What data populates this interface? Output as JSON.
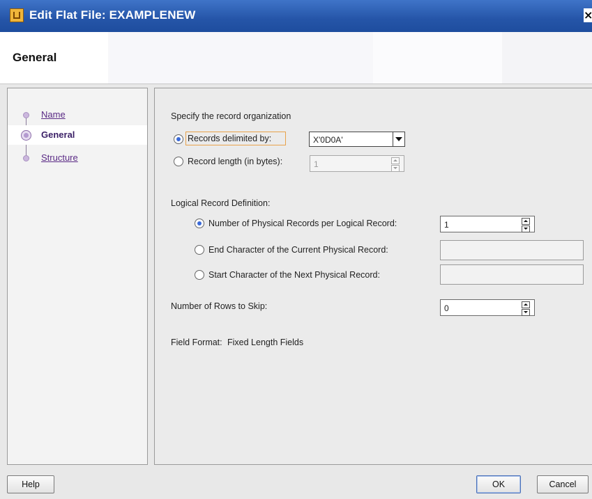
{
  "window": {
    "title": "Edit Flat File: EXAMPLENEW",
    "close_symbol": "×",
    "app_icon": "flat-file-icon"
  },
  "header": {
    "title": "General"
  },
  "nav": {
    "items": [
      {
        "label": "Name",
        "selected": false
      },
      {
        "label": "General",
        "selected": true
      },
      {
        "label": "Structure",
        "selected": false
      }
    ]
  },
  "record_org": {
    "section_label": "Specify the record organization",
    "delimited_label": "Records delimited by:",
    "delimited_selected": true,
    "delimiter_value": "X'0D0A'",
    "length_label": "Record length (in bytes):",
    "length_selected": false,
    "length_value": "1"
  },
  "logical": {
    "section_label": "Logical Record Definition:",
    "options": [
      {
        "label": "Number of Physical Records per Logical Record:",
        "selected": true,
        "value": "1"
      },
      {
        "label": "End Character of the Current Physical Record:",
        "selected": false,
        "value": ""
      },
      {
        "label": "Start Character of the Next Physical Record:",
        "selected": false,
        "value": ""
      }
    ]
  },
  "skip": {
    "label": "Number of Rows to Skip:",
    "value": "0"
  },
  "field_format": {
    "label": "Field Format:",
    "value": "Fixed Length Fields"
  },
  "buttons": {
    "help": "Help",
    "ok": "OK",
    "cancel": "Cancel"
  }
}
